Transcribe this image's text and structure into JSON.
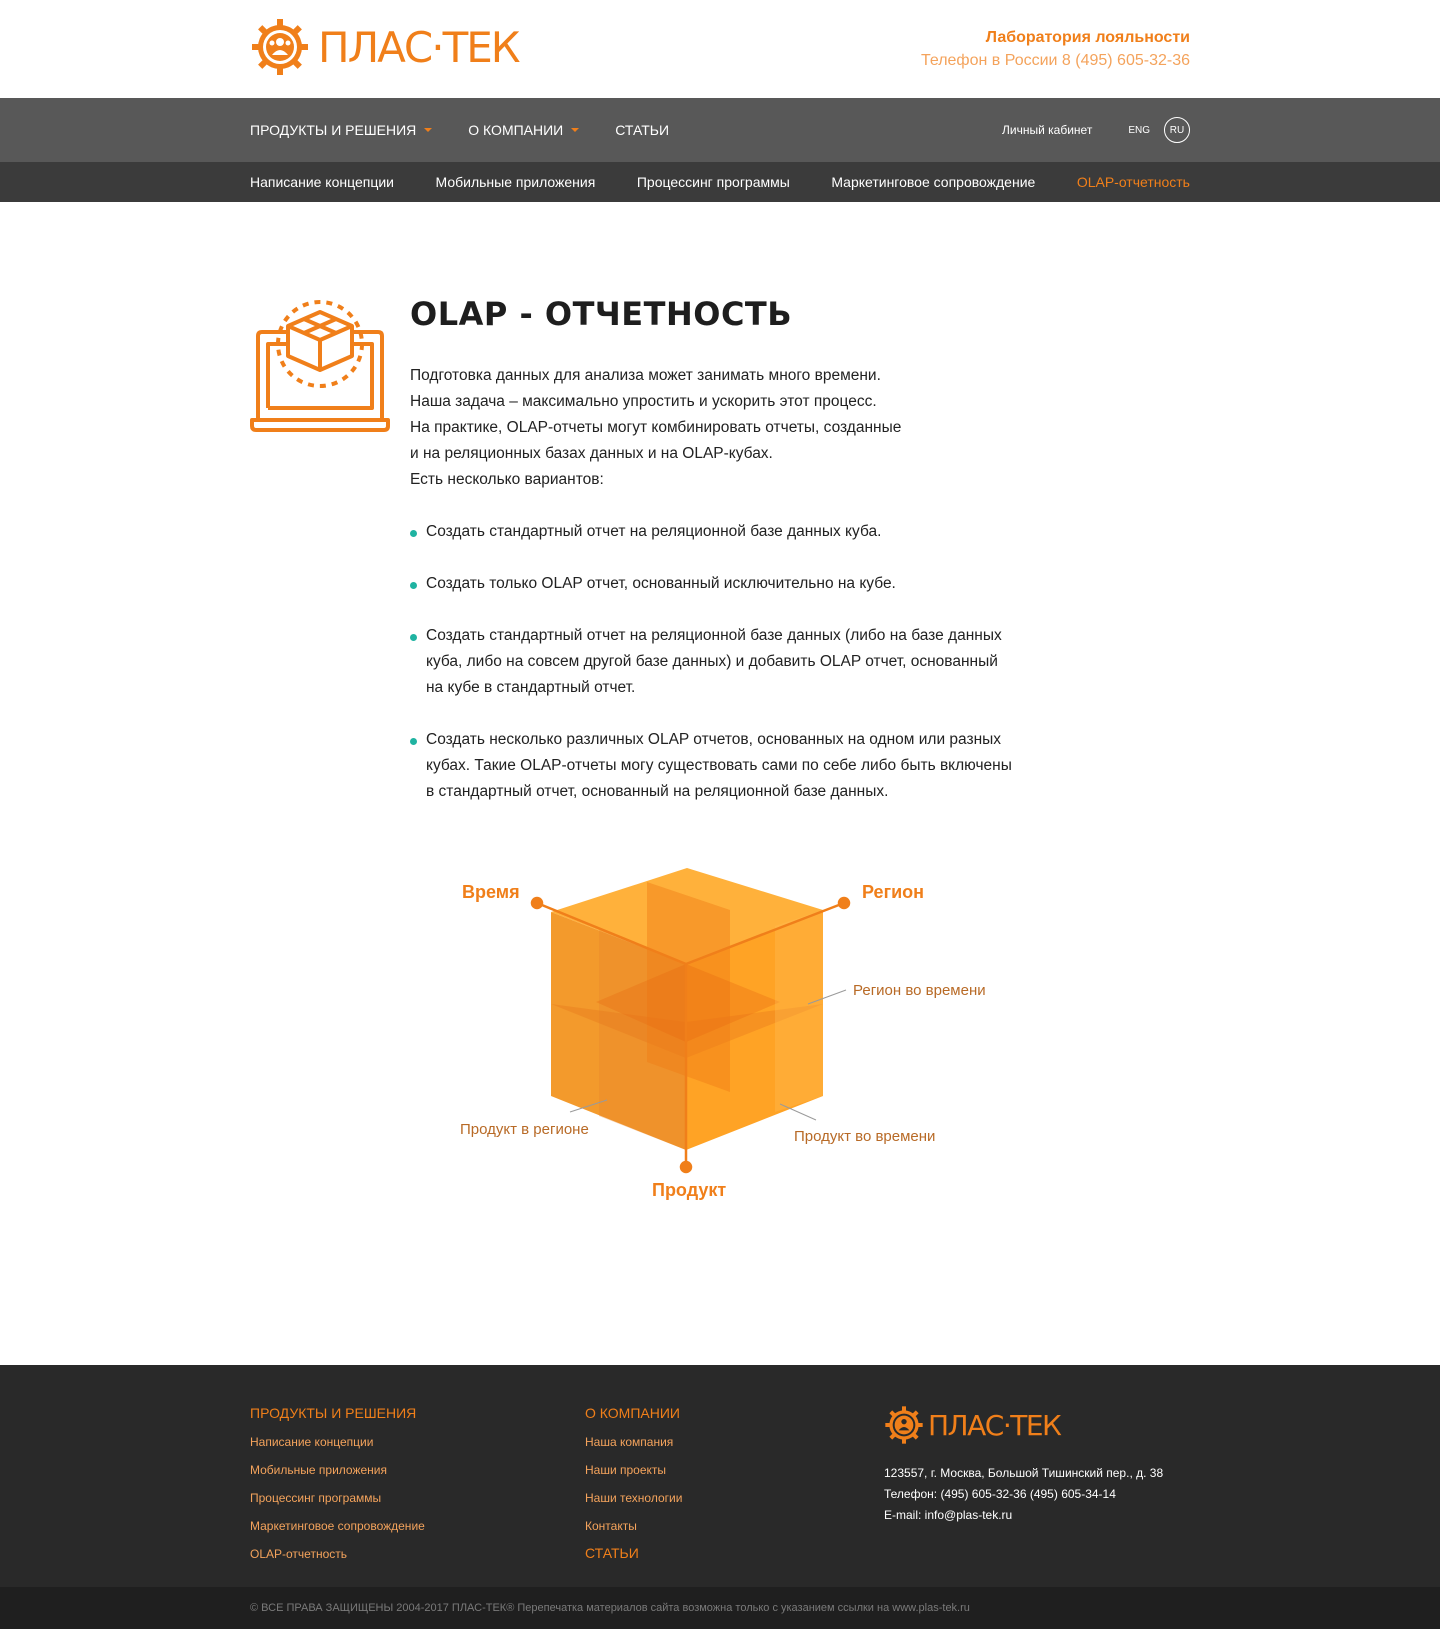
{
  "brand": {
    "name": "ПЛАС·ТЕК",
    "lab_title": "Лаборатория лояльности",
    "phone": "Телефон в России 8 (495) 605-32-36"
  },
  "nav": {
    "items": [
      {
        "label": "ПРОДУКТЫ И РЕШЕНИЯ"
      },
      {
        "label": "О КОМПАНИИ"
      },
      {
        "label": "СТАТЬИ"
      }
    ],
    "cabinet": "Личный кабинет",
    "lang_eng": "ENG",
    "lang_ru": "RU"
  },
  "subnav": {
    "items": [
      {
        "label": "Написание концепции"
      },
      {
        "label": "Мобильные приложения"
      },
      {
        "label": "Процессинг программы"
      },
      {
        "label": "Маркетинговое сопровождение"
      },
      {
        "label": "OLAP-отчетность"
      }
    ],
    "active_index": 4
  },
  "main": {
    "title": "OLAP - ОТЧЕТНОСТЬ",
    "intro": [
      "Подготовка данных для анализа может занимать много времени.",
      "Наша задача – максимально упростить и ускорить этот процесс.",
      "На практике, OLAP-отчеты могут комбинировать отчеты, созданные",
      "и на реляционных базах данных и на OLAP-кубах.",
      "Есть несколько вариантов:"
    ],
    "bullets": [
      [
        "Создать стандартный отчет на реляционной базе данных куба."
      ],
      [
        "Создать только OLAP отчет, основанный исключительно на кубе."
      ],
      [
        "Создать стандартный отчет на реляционной базе данных (либо на базе данных",
        "куба, либо на совсем другой базе данных) и добавить OLAP отчет, основанный",
        "на кубе в стандартный отчет."
      ],
      [
        "Создать несколько различных OLAP отчетов, основанных на одном или разных",
        "кубах. Такие OLAP-отчеты могу существовать сами по себе либо быть включены",
        "в стандартный отчет, основанный на реляционной базе данных."
      ]
    ]
  },
  "diagram": {
    "axis_time": "Время",
    "axis_region": "Регион",
    "axis_product": "Продукт",
    "label_region_time": "Регион во времени",
    "label_product_region": "Продукт в регионе",
    "label_product_time": "Продукт во времени"
  },
  "footer": {
    "col1_title": "ПРОДУКТЫ И РЕШЕНИЯ",
    "col1_links": [
      "Написание концепции",
      "Мобильные приложения",
      "Процессинг программы",
      "Маркетинговое сопровождение",
      "OLAP-отчетность"
    ],
    "col2_title": "О КОМПАНИИ",
    "col2_links": [
      "Наша компания",
      "Наши проекты",
      "Наши технологии",
      "Контакты"
    ],
    "col2_extra": "СТАТЬИ",
    "address": "123557, г. Москва, Большой Тишинский пер., д. 38",
    "phones": "Телефон: (495) 605-32-36 (495) 605-34-14",
    "email": "E-mail: info@plas-tek.ru",
    "copyright": "© ВСЕ ПРАВА ЗАЩИЩЕНЫ 2004-2017 ПЛАС-ТЕК®  Перепечатка материалов сайта возможна только с указанием ссылки на www.plas-tek.ru"
  },
  "colors": {
    "accent": "#f07f1a",
    "accent_light": "#f4a35c",
    "nav_bg": "#585858",
    "subnav_bg": "#3b3b3b",
    "footer_bg": "#292929",
    "bullet": "#1fb3a1"
  },
  "icons": [
    "gear-logo-icon",
    "laptop-cube-icon",
    "caret-down-icon"
  ]
}
